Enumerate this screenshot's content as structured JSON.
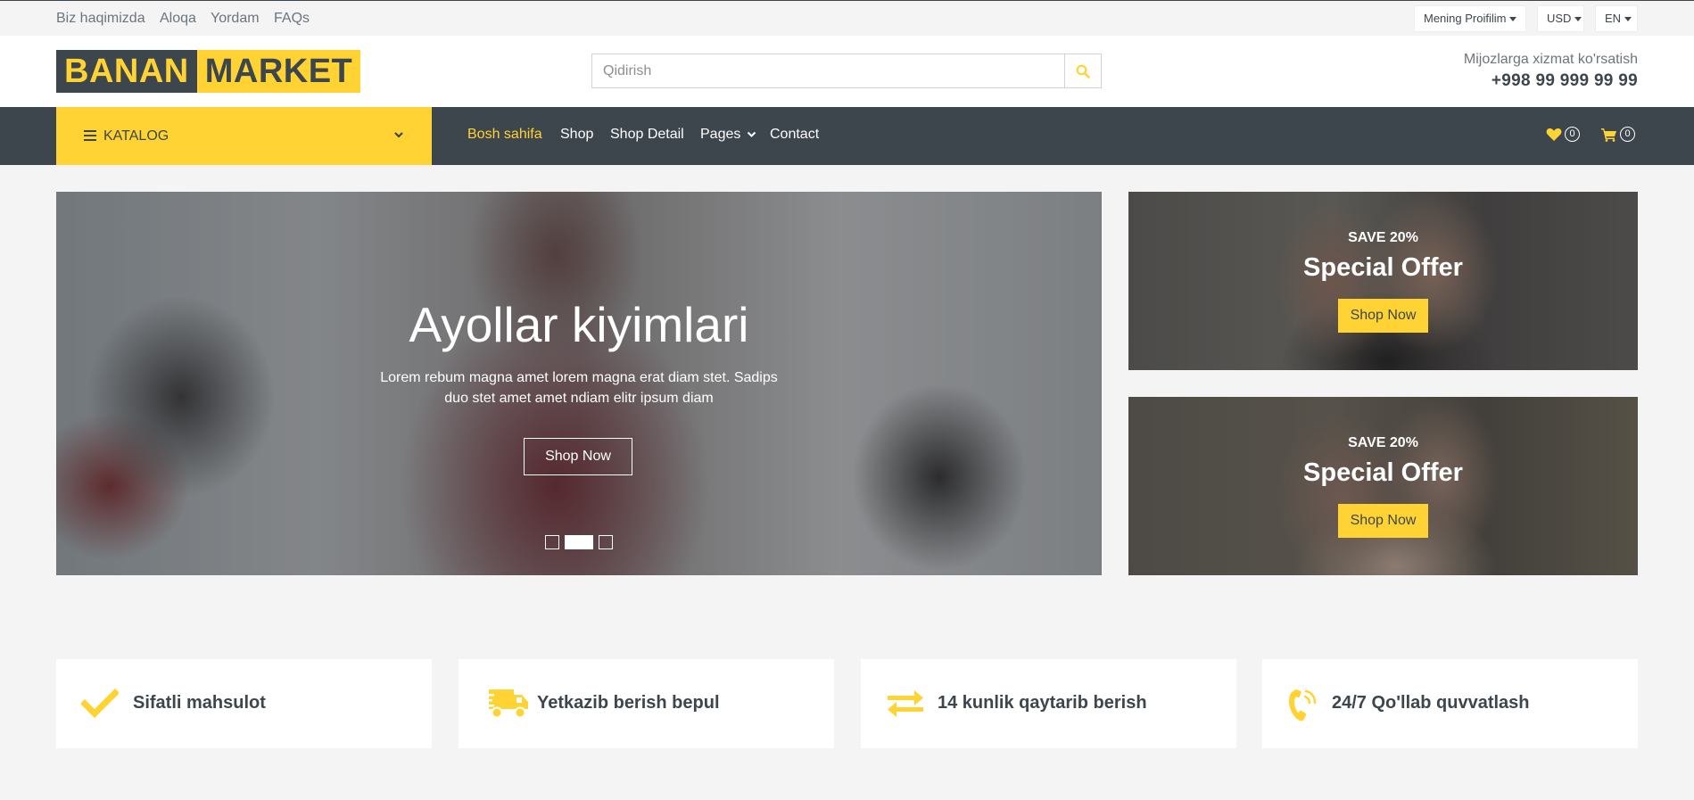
{
  "topbar": {
    "links": [
      "Biz haqimizda",
      "Aloqa",
      "Yordam",
      "FAQs"
    ],
    "profile": "Mening Proifilim",
    "currency": "USD",
    "language": "EN"
  },
  "header": {
    "logo_part1": "BANAN",
    "logo_part2": "MARKET",
    "search_placeholder": "Qidirish",
    "customer_service_label": "Mijozlarga xizmat ko'rsatish",
    "phone": "+998 99 999 99 99"
  },
  "navbar": {
    "catalog_label": "KATALOG",
    "links": [
      "Bosh sahifa",
      "Shop",
      "Shop Detail",
      "Pages",
      "Contact"
    ],
    "active_index": 0,
    "wishlist_count": "0",
    "cart_count": "0"
  },
  "hero": {
    "title": "Ayollar kiyimlari",
    "text": "Lorem rebum magna amet lorem magna erat diam stet. Sadips duo stet amet amet ndiam elitr ipsum diam",
    "button": "Shop Now",
    "active_slide": 1,
    "slide_count": 3
  },
  "offers": [
    {
      "save": "SAVE 20%",
      "title": "Special Offer",
      "button": "Shop Now"
    },
    {
      "save": "SAVE 20%",
      "title": "Special Offer",
      "button": "Shop Now"
    }
  ],
  "features": [
    {
      "icon": "check-icon",
      "text": "Sifatli mahsulot"
    },
    {
      "icon": "shipping-fast-icon",
      "text": "Yetkazib berish bepul"
    },
    {
      "icon": "exchange-icon",
      "text": "14 kunlik qaytarib berish"
    },
    {
      "icon": "phone-volume-icon",
      "text": "24/7 Qo'llab quvvatlash"
    }
  ],
  "colors": {
    "primary": "#ffd333",
    "dark": "#3d464d",
    "background": "#f4f4f4",
    "muted_text": "#6c757d"
  }
}
